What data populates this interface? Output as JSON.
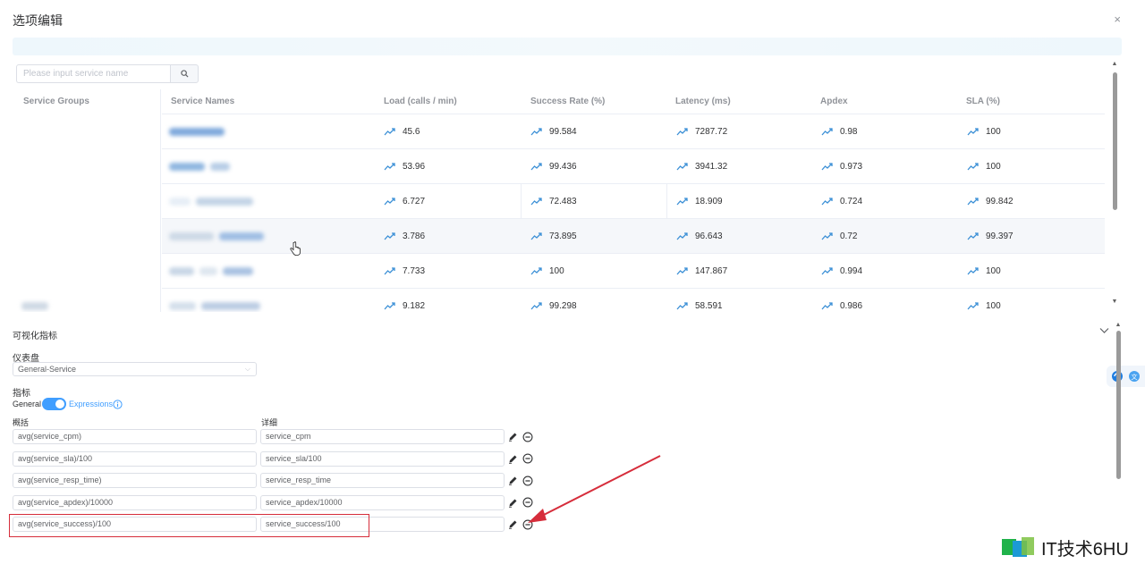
{
  "dialog": {
    "title": "选项编辑",
    "close": "×"
  },
  "search": {
    "placeholder": "Please input service name"
  },
  "table": {
    "headers": {
      "groups": "Service Groups",
      "names": "Service Names",
      "load": "Load (calls / min)",
      "success": "Success Rate (%)",
      "latency": "Latency (ms)",
      "apdex": "Apdex",
      "sla": "SLA (%)"
    },
    "rows": [
      {
        "load": "45.6",
        "success": "99.584",
        "latency": "7287.72",
        "apdex": "0.98",
        "sla": "100"
      },
      {
        "load": "53.96",
        "success": "99.436",
        "latency": "3941.32",
        "apdex": "0.973",
        "sla": "100"
      },
      {
        "load": "6.727",
        "success": "72.483",
        "latency": "18.909",
        "apdex": "0.724",
        "sla": "99.842"
      },
      {
        "load": "3.786",
        "success": "73.895",
        "latency": "96.643",
        "apdex": "0.72",
        "sla": "99.397"
      },
      {
        "load": "7.733",
        "success": "100",
        "latency": "147.867",
        "apdex": "0.994",
        "sla": "100"
      },
      {
        "load": "9.182",
        "success": "99.298",
        "latency": "58.591",
        "apdex": "0.986",
        "sla": "100"
      }
    ]
  },
  "metrics": {
    "section_title": "可视化指标",
    "dashboard_label": "仪表盘",
    "dashboard_value": "General-Service",
    "indicator_label": "指标",
    "general_label": "General",
    "expressions_label": "Expressions",
    "summary_label": "概括",
    "detail_label": "详细",
    "rows": [
      {
        "summary": "avg(service_cpm)",
        "detail": "service_cpm"
      },
      {
        "summary": "avg(service_sla)/100",
        "detail": "service_sla/100"
      },
      {
        "summary": "avg(service_resp_time)",
        "detail": "service_resp_time"
      },
      {
        "summary": "avg(service_apdex)/10000",
        "detail": "service_apdex/10000"
      },
      {
        "summary": "avg(service_success)/100",
        "detail": "service_success/100"
      }
    ]
  },
  "watermark": {
    "text": "IT技术6HU"
  },
  "colors": {
    "accent": "#409eff",
    "annotation": "#d62d3b",
    "trend": "#3a8fd6"
  }
}
